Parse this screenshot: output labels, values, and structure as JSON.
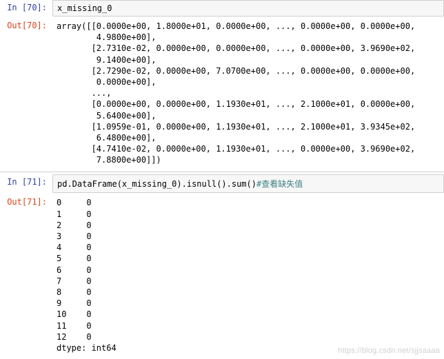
{
  "cells": [
    {
      "in_label": "In  [70]:",
      "code": "x_missing_0",
      "out_label": "Out[70]:",
      "output": "array([[0.0000e+00, 1.8000e+01, 0.0000e+00, ..., 0.0000e+00, 0.0000e+00,\n        4.9800e+00],\n       [2.7310e-02, 0.0000e+00, 0.0000e+00, ..., 0.0000e+00, 3.9690e+02,\n        9.1400e+00],\n       [2.7290e-02, 0.0000e+00, 7.0700e+00, ..., 0.0000e+00, 0.0000e+00,\n        0.0000e+00],\n       ...,\n       [0.0000e+00, 0.0000e+00, 1.1930e+01, ..., 2.1000e+01, 0.0000e+00,\n        5.6400e+00],\n       [1.0959e-01, 0.0000e+00, 1.1930e+01, ..., 2.1000e+01, 3.9345e+02,\n        6.4800e+00],\n       [4.7410e-02, 0.0000e+00, 1.1930e+01, ..., 0.0000e+00, 3.9690e+02,\n        7.8800e+00]])"
    },
    {
      "in_label": "In  [71]:",
      "code": "pd.DataFrame(x_missing_0).isnull().sum()",
      "comment": "#查看缺失值",
      "out_label": "Out[71]:",
      "output": "0     0\n1     0\n2     0\n3     0\n4     0\n5     0\n6     0\n7     0\n8     0\n9     0\n10    0\n11    0\n12    0\ndtype: int64"
    }
  ],
  "watermark": "https://blog.csdn.net/sjjsaaaa"
}
